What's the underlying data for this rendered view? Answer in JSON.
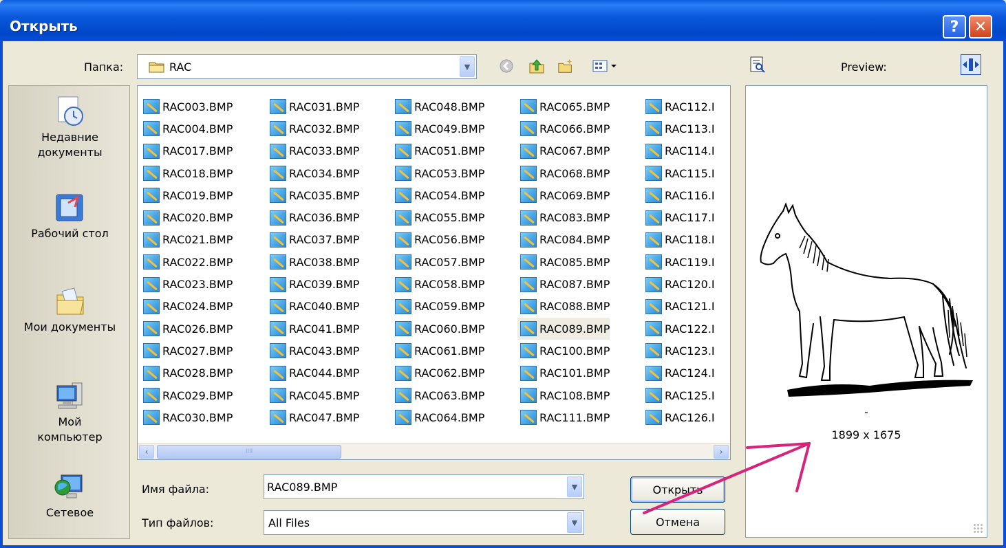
{
  "window": {
    "title": "Открыть",
    "help_glyph": "?",
    "close_glyph": "✕"
  },
  "toolbar": {
    "folder_label": "Папка:",
    "folder_value": "RAC",
    "icons": [
      "back-icon",
      "up-folder-icon",
      "new-folder-icon",
      "view-menu-icon"
    ]
  },
  "preview_header": {
    "label": "Preview:"
  },
  "places": [
    {
      "label": "Недавние\nдокументы",
      "icon": "recent-documents-icon"
    },
    {
      "label": "Рабочий стол",
      "icon": "desktop-icon"
    },
    {
      "label": "Мои документы",
      "icon": "my-documents-icon"
    },
    {
      "label": "Мой\nкомпьютер",
      "icon": "my-computer-icon"
    },
    {
      "label": "Сетевое",
      "icon": "network-icon"
    }
  ],
  "files": {
    "selected": "RAC089.BMP",
    "columns": [
      [
        "RAC003.BMP",
        "RAC004.BMP",
        "RAC017.BMP",
        "RAC018.BMP",
        "RAC019.BMP",
        "RAC020.BMP",
        "RAC021.BMP",
        "RAC022.BMP",
        "RAC023.BMP",
        "RAC024.BMP",
        "RAC026.BMP",
        "RAC027.BMP",
        "RAC028.BMP",
        "RAC029.BMP",
        "RAC030.BMP"
      ],
      [
        "RAC031.BMP",
        "RAC032.BMP",
        "RAC033.BMP",
        "RAC034.BMP",
        "RAC035.BMP",
        "RAC036.BMP",
        "RAC037.BMP",
        "RAC038.BMP",
        "RAC039.BMP",
        "RAC040.BMP",
        "RAC041.BMP",
        "RAC043.BMP",
        "RAC044.BMP",
        "RAC045.BMP",
        "RAC047.BMP"
      ],
      [
        "RAC048.BMP",
        "RAC049.BMP",
        "RAC051.BMP",
        "RAC053.BMP",
        "RAC054.BMP",
        "RAC055.BMP",
        "RAC056.BMP",
        "RAC057.BMP",
        "RAC058.BMP",
        "RAC059.BMP",
        "RAC060.BMP",
        "RAC061.BMP",
        "RAC062.BMP",
        "RAC063.BMP",
        "RAC064.BMP"
      ],
      [
        "RAC065.BMP",
        "RAC066.BMP",
        "RAC067.BMP",
        "RAC068.BMP",
        "RAC069.BMP",
        "RAC083.BMP",
        "RAC084.BMP",
        "RAC085.BMP",
        "RAC087.BMP",
        "RAC088.BMP",
        "RAC089.BMP",
        "RAC100.BMP",
        "RAC101.BMP",
        "RAC108.BMP",
        "RAC111.BMP"
      ],
      [
        "RAC112.I",
        "RAC113.I",
        "RAC114.I",
        "RAC115.I",
        "RAC116.I",
        "RAC117.I",
        "RAC118.I",
        "RAC119.I",
        "RAC120.I",
        "RAC121.I",
        "RAC122.I",
        "RAC123.I",
        "RAC124.I",
        "RAC125.I",
        "RAC126.I"
      ]
    ],
    "scroll_left": "‹",
    "scroll_right": "›",
    "thumb_grip": "IIII"
  },
  "form": {
    "filename_label": "Имя файла:",
    "filename_value": "RAC089.BMP",
    "filetype_label": "Тип файлов:",
    "filetype_value": "All Files",
    "open_button": "Открыть",
    "cancel_button": "Отмена"
  },
  "preview": {
    "dimensions": "1899 x 1675",
    "dash": "-"
  },
  "colors": {
    "annotation_arrow": "#d6247a",
    "titlebar": "#0b58dc",
    "selection": "#efede1"
  }
}
